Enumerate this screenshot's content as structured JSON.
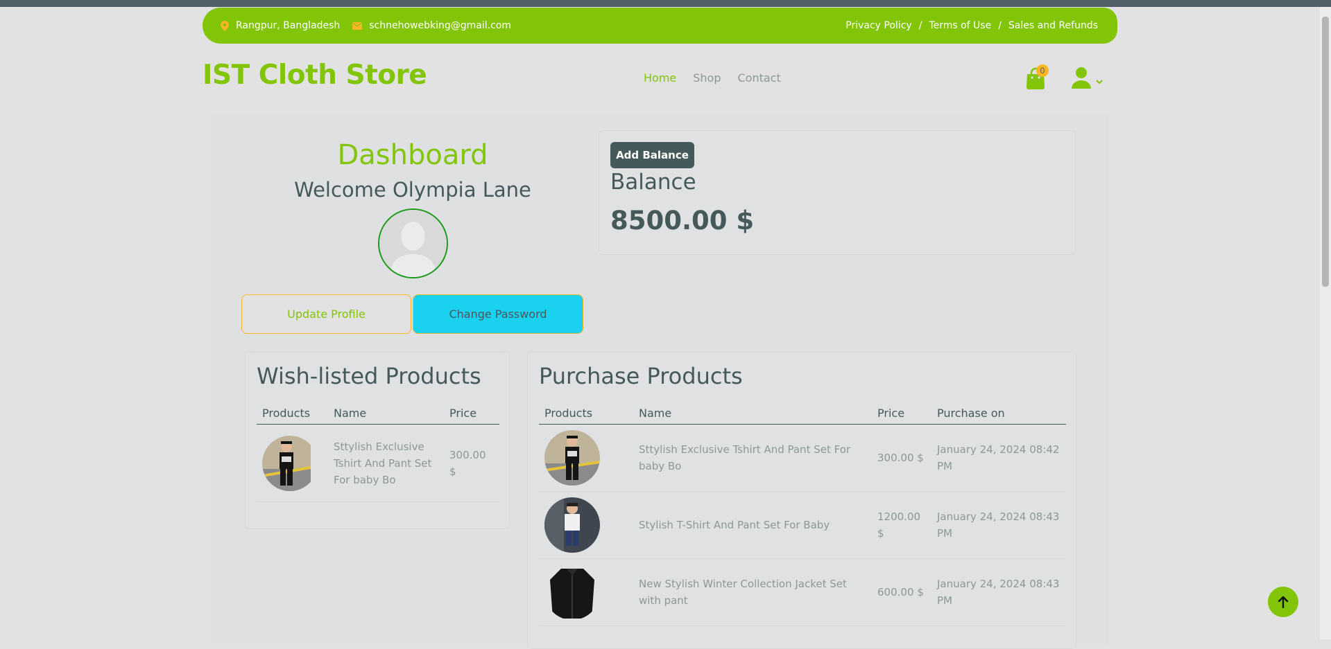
{
  "topbar": {
    "location": "Rangpur, Bangladesh",
    "email": "schnehowebking@gmail.com",
    "links": [
      "Privacy Policy",
      "Terms of Use",
      "Sales and Refunds"
    ],
    "separator": "/"
  },
  "header": {
    "brand": "IST Cloth Store",
    "nav": [
      "Home",
      "Shop",
      "Contact"
    ],
    "cart_count": "0"
  },
  "dashboard": {
    "title": "Dashboard",
    "welcome": "Welcome Olympia Lane",
    "update_profile": "Update Profile",
    "change_password": "Change Password"
  },
  "balance": {
    "add_button": "Add Balance",
    "label": "Balance",
    "value": "8500.00 $"
  },
  "wishlist": {
    "title": "Wish-listed Products",
    "columns": [
      "Products",
      "Name",
      "Price"
    ],
    "rows": [
      {
        "name": "Sttylish Exclusive Tshirt And Pant Set For baby Bo",
        "price": "300.00 $"
      }
    ]
  },
  "purchases": {
    "title": "Purchase Products",
    "columns": [
      "Products",
      "Name",
      "Price",
      "Purchase on"
    ],
    "rows": [
      {
        "name": "Sttylish Exclusive Tshirt And Pant Set For baby Bo",
        "price": "300.00 $",
        "date": "January 24, 2024 08:42 PM"
      },
      {
        "name": "Stylish T-Shirt And Pant Set For Baby",
        "price": "1200.00 $",
        "date": "January 24, 2024 08:43 PM"
      },
      {
        "name": "New Stylish Winter Collection Jacket Set with pant",
        "price": "600.00 $",
        "date": "January 24, 2024 08:43 PM"
      }
    ]
  },
  "colors": {
    "accent": "#81c408",
    "secondary": "#ffb524",
    "dark": "#45595b",
    "info": "#1ad2f0"
  }
}
